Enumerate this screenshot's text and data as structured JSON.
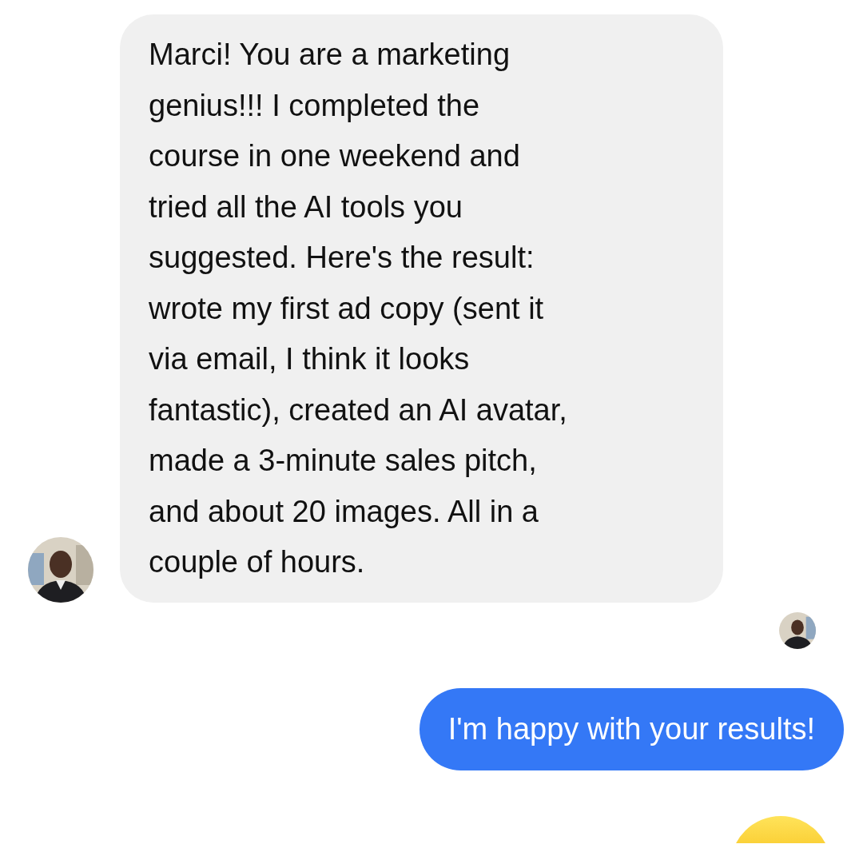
{
  "messages": [
    {
      "kind": "incoming",
      "lines": [
        "Marci! You are a marketing",
        "genius!!! I completed the",
        "course in one weekend and",
        "tried all the AI tools you",
        "suggested. Here's the result:",
        "wrote my first ad copy (sent it",
        "via email, I think it looks",
        "fantastic), created an AI avatar,",
        "made a 3-minute sales pitch,",
        "and about 20 images. All in a",
        "couple of hours."
      ]
    },
    {
      "kind": "receipt"
    },
    {
      "kind": "outgoing",
      "lines": [
        "I'm happy with your results!"
      ]
    },
    {
      "kind": "emoji"
    }
  ]
}
